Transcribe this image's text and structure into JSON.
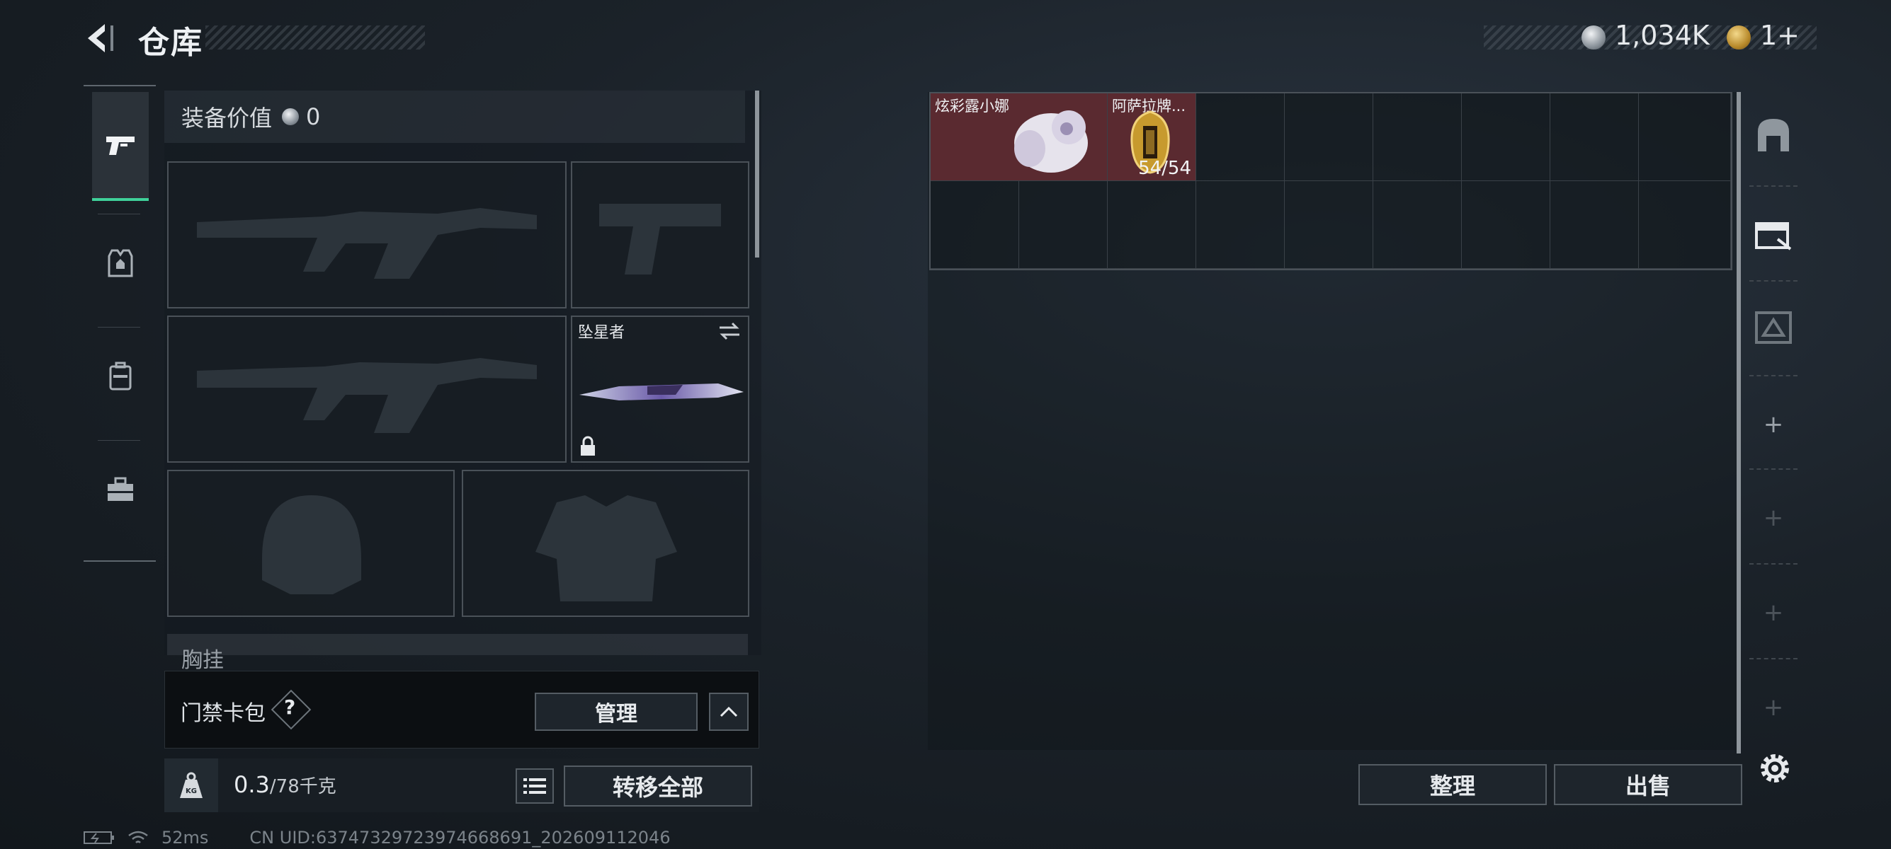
{
  "header": {
    "title": "仓库",
    "currency_silver": "1,034K",
    "currency_gold": "1+"
  },
  "equipment": {
    "value_label": "装备价值",
    "value": "0",
    "melee_name": "坠星者",
    "chest_label": "胸挂"
  },
  "card_pack": {
    "label": "门禁卡包",
    "help": "?",
    "manage": "管理"
  },
  "weight": {
    "current": "0.3",
    "capacity": "/78千克",
    "icon_text": "KG"
  },
  "transfer_all": "转移全部",
  "status": {
    "ping": "52ms",
    "uid": "CN UID:63747329723974668691_202609112046"
  },
  "storage": {
    "items": [
      {
        "name": "炫彩露小娜",
        "count": ""
      },
      {
        "name": "阿萨拉牌...",
        "count": "54/54"
      }
    ]
  },
  "buttons": {
    "sort": "整理",
    "sell": "出售"
  },
  "colors": {
    "accent": "#3fd19a",
    "item_highlight": "#6a2f34"
  }
}
